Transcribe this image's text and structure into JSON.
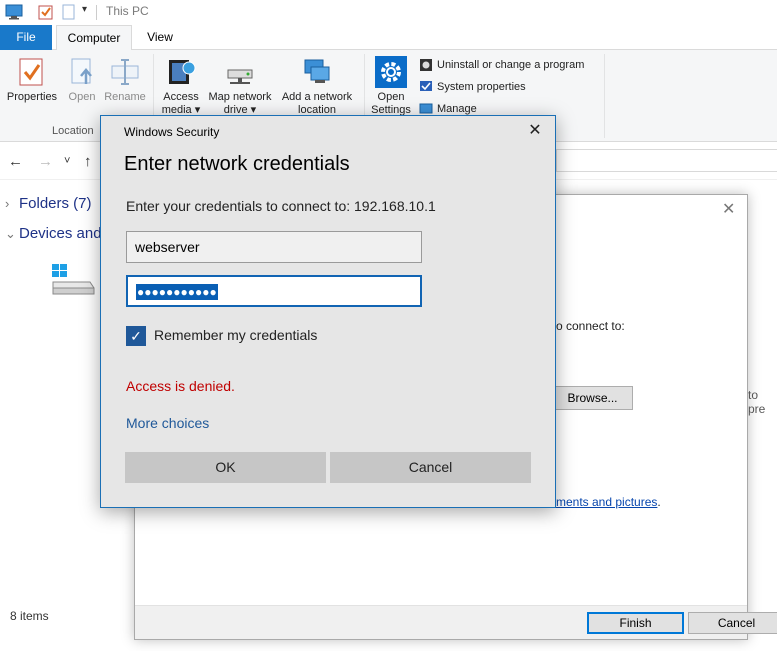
{
  "window": {
    "title": "This PC"
  },
  "ribbon": {
    "tabs": [
      "File",
      "Computer",
      "View"
    ],
    "buttons": {
      "properties": "Properties",
      "open": "Open",
      "rename": "Rename",
      "access_media_1": "Access",
      "access_media_2": "media ▾",
      "map_drive_1": "Map network",
      "map_drive_2": "drive ▾",
      "add_location_1": "Add a network",
      "add_location_2": "location",
      "open_settings_1": "Open",
      "open_settings_2": "Settings"
    },
    "small_buttons": {
      "uninstall": "Uninstall or change a program",
      "system_properties": "System properties",
      "manage": "Manage"
    },
    "group_location": "Location"
  },
  "navigation": {
    "back": "←",
    "forward": "→",
    "recent": "˅",
    "up": "↑"
  },
  "explorer": {
    "folders_group": "Folders (7)",
    "devices_group": "Devices and",
    "status": "8 items"
  },
  "wizard": {
    "connect_text": "o connect to:",
    "browse_button": "Browse...",
    "right_clip": "to pre",
    "link_text": "ments and pictures",
    "link_period": ".",
    "finish_button": "Finish",
    "cancel_button": "Cancel"
  },
  "credentials_dialog": {
    "caption": "Windows Security",
    "heading": "Enter network credentials",
    "prompt": "Enter your credentials to connect to: 192.168.10.1",
    "username": "webserver",
    "password_mask": "●●●●●●●●●●●",
    "remember_label": "Remember my credentials",
    "remember_checked": true,
    "error": "Access is denied.",
    "more_choices": "More choices",
    "ok_button": "OK",
    "cancel_button": "Cancel"
  },
  "colors": {
    "accent": "#1979ca",
    "error": "#c00000",
    "link": "#1f5899",
    "dialog_bg": "#e6e6e6"
  }
}
